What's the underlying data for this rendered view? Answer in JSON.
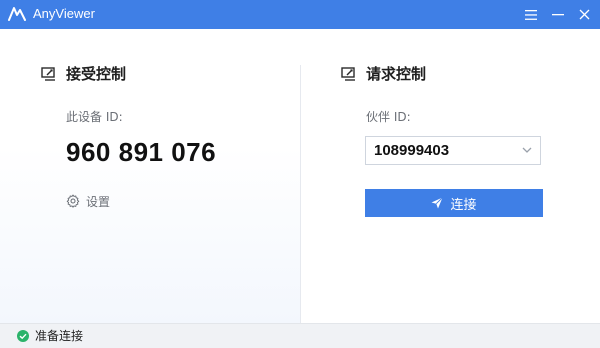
{
  "window": {
    "title": "AnyViewer"
  },
  "colors": {
    "accent": "#3f7fe6",
    "status_ok": "#2bb36a"
  },
  "titlebar_icons": [
    "anyviewer-logo-icon",
    "menu-icon",
    "minimize-icon",
    "close-icon"
  ],
  "receive": {
    "title": "接受控制",
    "icon": "screen-edit-icon",
    "device_id_label": "此设备 ID:",
    "device_id": "960 891 076",
    "settings_label": "设置",
    "settings_icon": "gear-icon"
  },
  "request": {
    "title": "请求控制",
    "icon": "screen-edit-icon",
    "partner_id_label": "伙伴 ID:",
    "partner_id_value": "108999403",
    "dropdown_icon": "chevron-down-icon",
    "connect_label": "连接",
    "connect_icon": "send-icon"
  },
  "status": {
    "text": "准备连接",
    "icon": "check-circle-icon"
  }
}
